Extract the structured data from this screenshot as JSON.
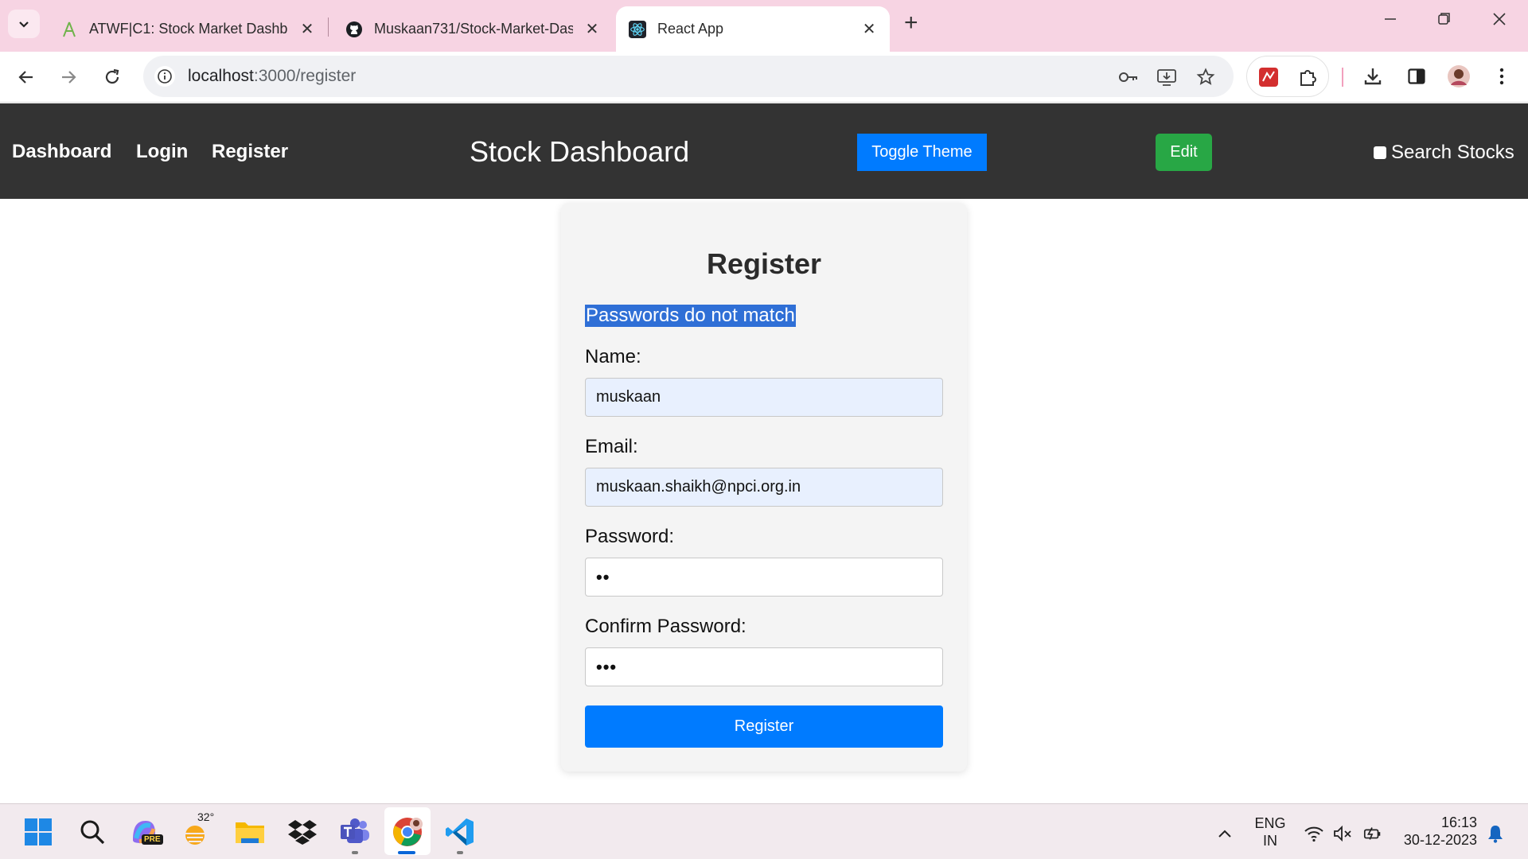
{
  "browser": {
    "tabs": [
      {
        "title": "ATWF|C1: Stock Market Dashbo",
        "icon": "atwf-icon",
        "active": false
      },
      {
        "title": "Muskaan731/Stock-Market-Das",
        "icon": "github-icon",
        "active": false
      },
      {
        "title": "React App",
        "icon": "react-icon",
        "active": true
      }
    ],
    "url_host": "localhost",
    "url_path": ":3000/register"
  },
  "navbar": {
    "links": [
      "Dashboard",
      "Login",
      "Register"
    ],
    "title": "Stock Dashboard",
    "toggle_theme_label": "Toggle Theme",
    "edit_label": "Edit",
    "search_stocks_label": "Search Stocks",
    "search_stocks_checked": false
  },
  "register": {
    "heading": "Register",
    "error": "Passwords do not match",
    "name_label": "Name:",
    "name_value": "muskaan",
    "email_label": "Email:",
    "email_value": "muskaan.shaikh@npci.org.in",
    "password_label": "Password:",
    "password_mask": "••",
    "confirm_label": "Confirm Password:",
    "confirm_mask": "•••",
    "submit_label": "Register"
  },
  "taskbar": {
    "weather_temp": "32°",
    "copilot_badge": "PRE",
    "language_line1": "ENG",
    "language_line2": "IN",
    "time": "16:13",
    "date": "30-12-2023"
  },
  "colors": {
    "navbar_bg": "#333333",
    "primary": "#007bff",
    "success": "#28a745",
    "tabbar_bg": "#f7d4e3",
    "selection": "#2f6fd6",
    "autofill_bg": "#e8f0fe"
  }
}
